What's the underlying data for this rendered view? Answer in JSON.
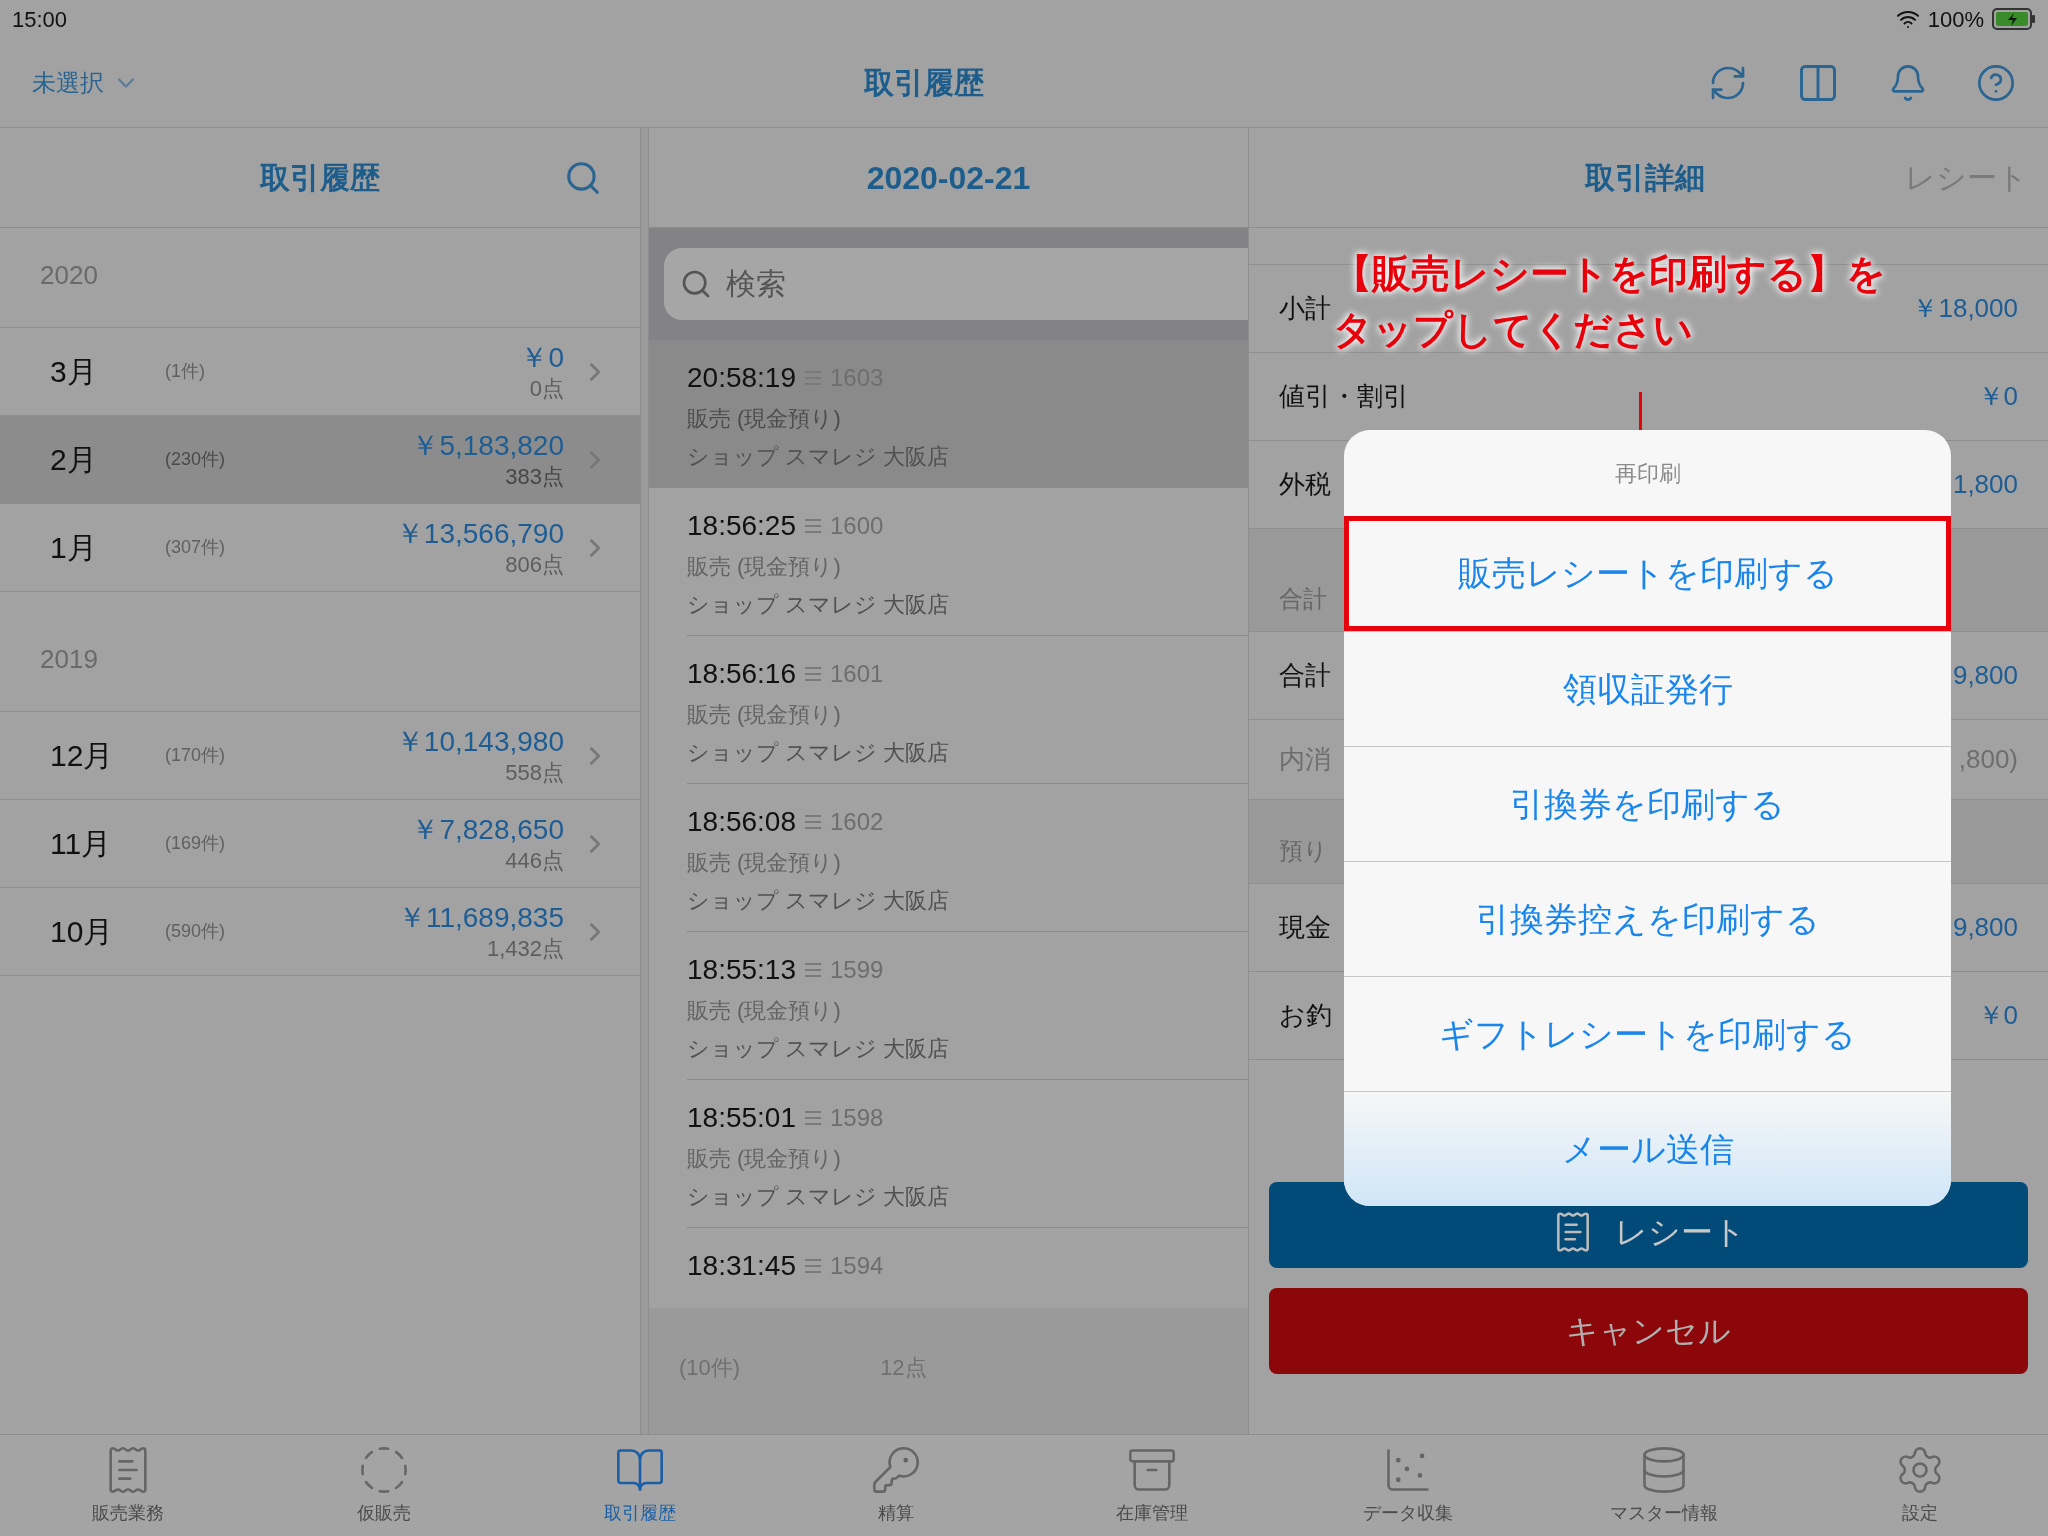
{
  "status_bar": {
    "time": "15:00",
    "battery": "100%"
  },
  "nav": {
    "store_selector": "未選択",
    "title": "取引履歴"
  },
  "months_panel": {
    "title": "取引履歴",
    "groups": [
      {
        "year": "2020",
        "months": [
          {
            "month": "3月",
            "count": "(1件)",
            "amount": "￥0",
            "points": "0点",
            "selected": false
          },
          {
            "month": "2月",
            "count": "(230件)",
            "amount": "￥5,183,820",
            "points": "383点",
            "selected": true
          },
          {
            "month": "1月",
            "count": "(307件)",
            "amount": "￥13,566,790",
            "points": "806点",
            "selected": false
          }
        ]
      },
      {
        "year": "2019",
        "months": [
          {
            "month": "12月",
            "count": "(170件)",
            "amount": "￥10,143,980",
            "points": "558点",
            "selected": false
          },
          {
            "month": "11月",
            "count": "(169件)",
            "amount": "￥7,828,650",
            "points": "446点",
            "selected": false
          },
          {
            "month": "10月",
            "count": "(590件)",
            "amount": "￥11,689,835",
            "points": "1,432点",
            "selected": false
          }
        ]
      }
    ]
  },
  "transactions_panel": {
    "title": "2020-02-21",
    "search": {
      "placeholder": "検索"
    },
    "rows": [
      {
        "time": "20:58:19",
        "number": "1603",
        "type": "販売 (現金預り)",
        "shop": "ショップ スマレジ 大阪店",
        "selected": true
      },
      {
        "time": "18:56:25",
        "number": "1600",
        "type": "販売 (現金預り)",
        "shop": "ショップ スマレジ 大阪店",
        "selected": false
      },
      {
        "time": "18:56:16",
        "number": "1601",
        "type": "販売 (現金預り)",
        "shop": "ショップ スマレジ 大阪店",
        "selected": false
      },
      {
        "time": "18:56:08",
        "number": "1602",
        "type": "販売 (現金預り)",
        "shop": "ショップ スマレジ 大阪店",
        "selected": false
      },
      {
        "time": "18:55:13",
        "number": "1599",
        "type": "販売 (現金預り)",
        "shop": "ショップ スマレジ 大阪店",
        "selected": false
      },
      {
        "time": "18:55:01",
        "number": "1598",
        "type": "販売 (現金預り)",
        "shop": "ショップ スマレジ 大阪店",
        "selected": false
      },
      {
        "time": "18:31:45",
        "number": "1594",
        "selected": false
      }
    ],
    "footer": {
      "count": "(10件)",
      "points": "12点"
    }
  },
  "detail_panel": {
    "tabs": [
      {
        "label": "取引詳細",
        "selected": true
      },
      {
        "label": "レシート",
        "selected": false
      }
    ],
    "rows": [
      {
        "kind": "row",
        "label": "小計",
        "value": "￥18,000"
      },
      {
        "kind": "row",
        "label": "値引・割引",
        "value": "￥0"
      },
      {
        "kind": "row",
        "label": "外税",
        "value": "1,800"
      },
      {
        "kind": "section",
        "label": "合計"
      },
      {
        "kind": "row",
        "label": "合計",
        "value": "9,800"
      },
      {
        "kind": "subrow",
        "label": "内消",
        "value": ",800)"
      },
      {
        "kind": "section",
        "label": "預り"
      },
      {
        "kind": "row",
        "label": "現金",
        "value": "9,800"
      },
      {
        "kind": "row",
        "label": "お釣",
        "value": "￥0"
      }
    ],
    "receipt_button": "レシート",
    "cancel_button": "キャンセル"
  },
  "popover": {
    "title": "再印刷",
    "items": [
      {
        "label": "販売レシートを印刷する",
        "highlighted": true
      },
      {
        "label": "領収証発行",
        "highlighted": false
      },
      {
        "label": "引換券を印刷する",
        "highlighted": false
      },
      {
        "label": "引換券控えを印刷する",
        "highlighted": false
      },
      {
        "label": "ギフトレシートを印刷する",
        "highlighted": false
      },
      {
        "label": "メール送信",
        "highlighted": false
      }
    ]
  },
  "callout": {
    "lines": [
      "【販売レシートを印刷する】を",
      "タップしてください"
    ]
  },
  "tab_bar": [
    {
      "label": "販売業務",
      "selected": false
    },
    {
      "label": "仮販売",
      "selected": false
    },
    {
      "label": "取引履歴",
      "selected": true
    },
    {
      "label": "精算",
      "selected": false
    },
    {
      "label": "在庫管理",
      "selected": false
    },
    {
      "label": "データ収集",
      "selected": false
    },
    {
      "label": "マスター情報",
      "selected": false
    },
    {
      "label": "設定",
      "selected": false
    }
  ]
}
